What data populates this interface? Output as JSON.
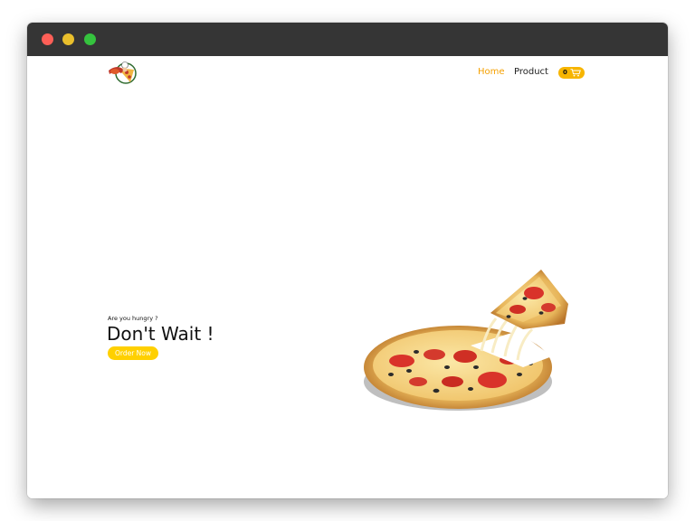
{
  "window": {
    "controls": [
      "close",
      "minimize",
      "maximize"
    ]
  },
  "header": {
    "logo_icon": "pizza-chef-logo-icon",
    "nav": {
      "home_label": "Home",
      "product_label": "Product"
    },
    "cart": {
      "count": "0",
      "icon": "cart-icon"
    }
  },
  "hero": {
    "kicker": "Are you hungry ?",
    "title": "Don't Wait !",
    "button_label": "Order Now",
    "image_icon": "pizza-image"
  },
  "colors": {
    "accent": "#f5a000",
    "button": "#ffd000",
    "titlebar": "#353535"
  }
}
